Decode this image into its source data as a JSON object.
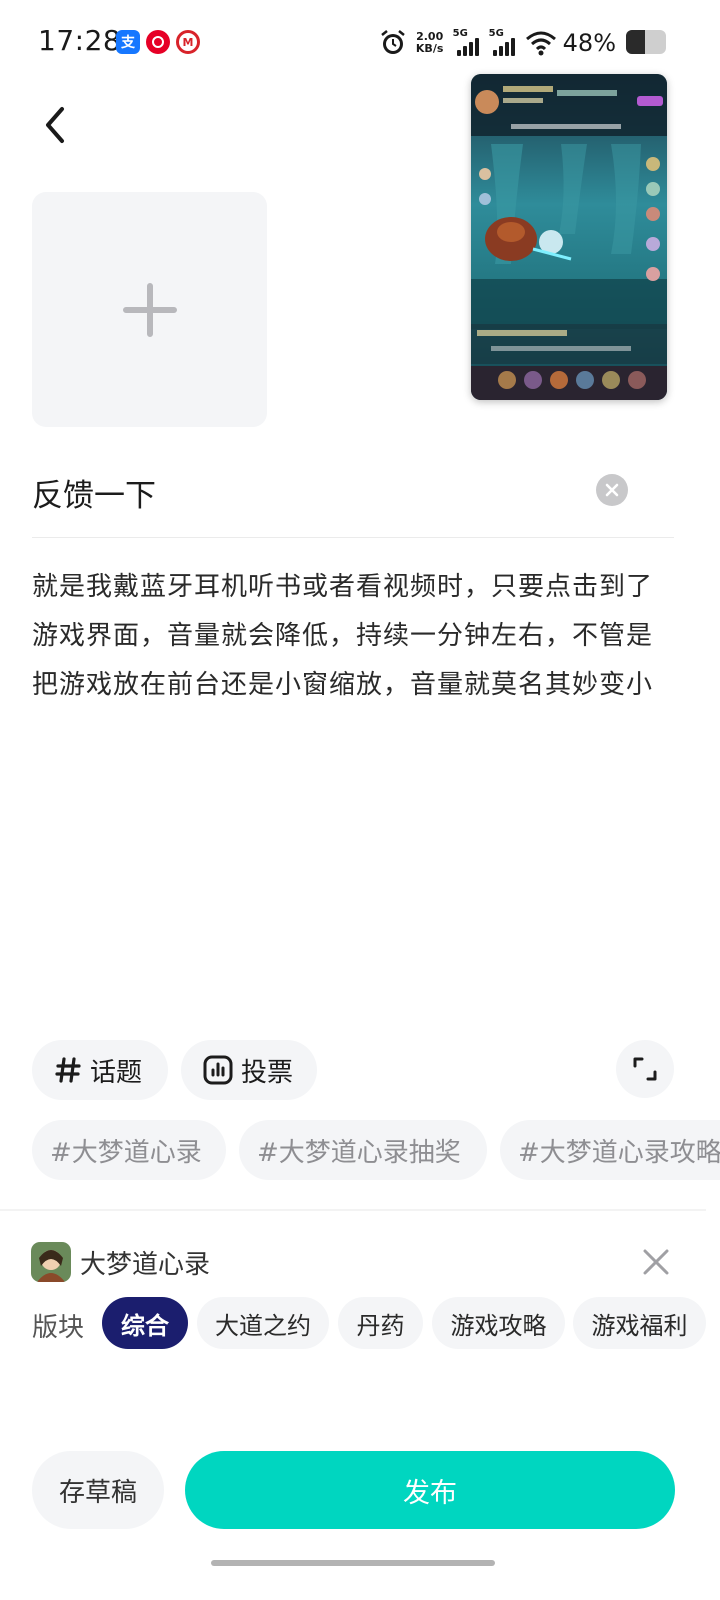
{
  "status_bar": {
    "time": "17:28",
    "net_speed_value": "2.00",
    "net_speed_unit": "KB/s",
    "signal_1_label": "5G",
    "signal_2_label": "5G",
    "battery_percent": "48%",
    "battery_level": 0.48,
    "app_icons": [
      "alipay-icon",
      "netease-music-icon",
      "metro-icon"
    ]
  },
  "editor": {
    "title": "反馈一下",
    "body": "就是我戴蓝牙耳机听书或者看视频时，只要点击到了游戏界面，音量就会降低，持续一分钟左右，不管是把游戏放在前台还是小窗缩放，音量就莫名其妙变小"
  },
  "tools": {
    "topic_label": "话题",
    "vote_label": "投票"
  },
  "suggested_tags": [
    "#大梦道心录",
    "#大梦道心录抽奖",
    "#大梦道心录攻略"
  ],
  "game": {
    "name": "大梦道心录"
  },
  "sections": {
    "label": "版块",
    "items": [
      "综合",
      "大道之约",
      "丹药",
      "游戏攻略",
      "游戏福利"
    ],
    "active_index": 0
  },
  "actions": {
    "draft_label": "存草稿",
    "publish_label": "发布"
  },
  "colors": {
    "accent": "#00d6c0",
    "active_chip": "#1b1e6e",
    "chip_bg": "#f4f5f7"
  }
}
